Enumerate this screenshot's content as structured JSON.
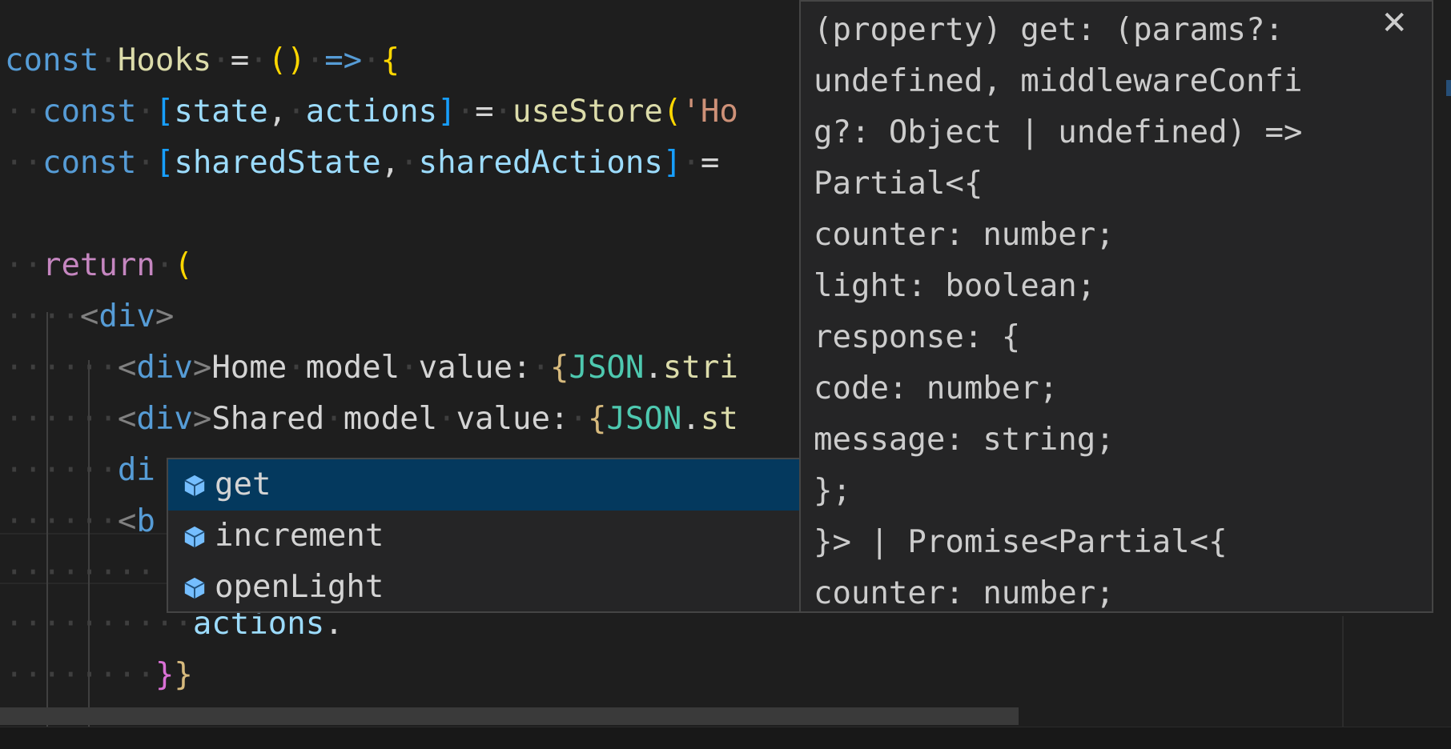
{
  "editor": {
    "lines": [
      {
        "id": "l1",
        "segments": [
          {
            "t": "const",
            "c": "kw"
          },
          {
            "t": "·",
            "c": "ws-dot"
          },
          {
            "t": "Hooks",
            "c": "fn"
          },
          {
            "t": "·",
            "c": "ws-dot"
          },
          {
            "t": "=",
            "c": "op"
          },
          {
            "t": "·",
            "c": "ws-dot"
          },
          {
            "t": "()",
            "c": "paren"
          },
          {
            "t": "·",
            "c": "ws-dot"
          },
          {
            "t": "=>",
            "c": "kw"
          },
          {
            "t": "·",
            "c": "ws-dot"
          },
          {
            "t": "{",
            "c": "paren"
          }
        ]
      },
      {
        "id": "l2",
        "segments": [
          {
            "t": "··",
            "c": "ws-dot"
          },
          {
            "t": "const",
            "c": "kw"
          },
          {
            "t": "·",
            "c": "ws-dot"
          },
          {
            "t": "[",
            "c": "bracket-blue"
          },
          {
            "t": "state",
            "c": "var"
          },
          {
            "t": ",",
            "c": "op"
          },
          {
            "t": "·",
            "c": "ws-dot"
          },
          {
            "t": "actions",
            "c": "var"
          },
          {
            "t": "]",
            "c": "bracket-blue"
          },
          {
            "t": "·",
            "c": "ws-dot"
          },
          {
            "t": "=",
            "c": "op"
          },
          {
            "t": "·",
            "c": "ws-dot"
          },
          {
            "t": "useStore",
            "c": "fn"
          },
          {
            "t": "(",
            "c": "paren"
          },
          {
            "t": "'Ho",
            "c": "str"
          }
        ]
      },
      {
        "id": "l3",
        "segments": [
          {
            "t": "··",
            "c": "ws-dot"
          },
          {
            "t": "const",
            "c": "kw"
          },
          {
            "t": "·",
            "c": "ws-dot"
          },
          {
            "t": "[",
            "c": "bracket-blue"
          },
          {
            "t": "sharedState",
            "c": "var"
          },
          {
            "t": ",",
            "c": "op"
          },
          {
            "t": "·",
            "c": "ws-dot"
          },
          {
            "t": "sharedActions",
            "c": "var"
          },
          {
            "t": "]",
            "c": "bracket-blue"
          },
          {
            "t": "·",
            "c": "ws-dot"
          },
          {
            "t": "=",
            "c": "op"
          }
        ]
      },
      {
        "id": "l4",
        "segments": []
      },
      {
        "id": "l5",
        "segments": [
          {
            "t": "··",
            "c": "ws-dot"
          },
          {
            "t": "return",
            "c": "kw-ret"
          },
          {
            "t": "·",
            "c": "ws-dot"
          },
          {
            "t": "(",
            "c": "paren"
          }
        ]
      },
      {
        "id": "l6",
        "segments": [
          {
            "t": "····",
            "c": "ws-dot"
          },
          {
            "t": "<",
            "c": "tag"
          },
          {
            "t": "div",
            "c": "tagname"
          },
          {
            "t": ">",
            "c": "tag"
          }
        ]
      },
      {
        "id": "l7",
        "segments": [
          {
            "t": "······",
            "c": "ws-dot"
          },
          {
            "t": "<",
            "c": "tag"
          },
          {
            "t": "div",
            "c": "tagname"
          },
          {
            "t": ">",
            "c": "tag"
          },
          {
            "t": "Home",
            "c": "plain"
          },
          {
            "t": "·",
            "c": "ws-dot"
          },
          {
            "t": "model",
            "c": "plain"
          },
          {
            "t": "·",
            "c": "ws-dot"
          },
          {
            "t": "value:",
            "c": "plain"
          },
          {
            "t": "·",
            "c": "ws-dot"
          },
          {
            "t": "{",
            "c": "orange"
          },
          {
            "t": "JSON",
            "c": "cls"
          },
          {
            "t": ".",
            "c": "op"
          },
          {
            "t": "stri",
            "c": "fn"
          }
        ]
      },
      {
        "id": "l8",
        "segments": [
          {
            "t": "······",
            "c": "ws-dot"
          },
          {
            "t": "<",
            "c": "tag"
          },
          {
            "t": "div",
            "c": "tagname"
          },
          {
            "t": ">",
            "c": "tag"
          },
          {
            "t": "Shared",
            "c": "plain"
          },
          {
            "t": "·",
            "c": "ws-dot"
          },
          {
            "t": "model",
            "c": "plain"
          },
          {
            "t": "·",
            "c": "ws-dot"
          },
          {
            "t": "value:",
            "c": "plain"
          },
          {
            "t": "·",
            "c": "ws-dot"
          },
          {
            "t": "{",
            "c": "orange"
          },
          {
            "t": "JSON",
            "c": "cls"
          },
          {
            "t": ".",
            "c": "op"
          },
          {
            "t": "st",
            "c": "fn"
          }
        ]
      },
      {
        "id": "l9",
        "segments": [
          {
            "t": "······",
            "c": "ws-dot"
          },
          {
            "t": "di",
            "c": "tagname"
          }
        ]
      },
      {
        "id": "l10",
        "segments": [
          {
            "t": "······",
            "c": "ws-dot"
          },
          {
            "t": "<",
            "c": "tag"
          },
          {
            "t": "b",
            "c": "tagname"
          }
        ]
      },
      {
        "id": "l11",
        "segments": [
          {
            "t": "········",
            "c": "ws-dot"
          }
        ]
      },
      {
        "id": "l12",
        "segments": [
          {
            "t": "··········",
            "c": "ws-dot"
          },
          {
            "t": "actions",
            "c": "var"
          },
          {
            "t": ".",
            "c": "op"
          }
        ]
      },
      {
        "id": "l13",
        "segments": [
          {
            "t": "········",
            "c": "ws-dot"
          },
          {
            "t": "}",
            "c": "brace2"
          },
          {
            "t": "}",
            "c": "orange"
          }
        ]
      }
    ]
  },
  "suggest": {
    "items": [
      {
        "label": "get",
        "selected": true
      },
      {
        "label": "increment",
        "selected": false
      },
      {
        "label": "openLight",
        "selected": false
      }
    ]
  },
  "detail": {
    "close_label": "✕",
    "lines": [
      "(property) get: (params?:",
      "undefined, middlewareConfi",
      "g?: Object | undefined) =>",
      "Partial<{",
      "counter: number;",
      "light: boolean;",
      "response: {",
      "code: number;",
      "message: string;",
      "};",
      "}> | Promise<Partial<{",
      "counter: number;"
    ]
  },
  "colors": {
    "background": "#1e1e1e",
    "widget_bg": "#252526",
    "selection": "#04395e",
    "keyword": "#569cd6",
    "function": "#dcdcaa",
    "variable": "#9cdcfe",
    "string": "#ce9178",
    "class": "#4ec9b0",
    "method_icon": "#75beff"
  },
  "icons": {
    "suggest_item": "cube-method-icon",
    "close": "close-icon"
  }
}
